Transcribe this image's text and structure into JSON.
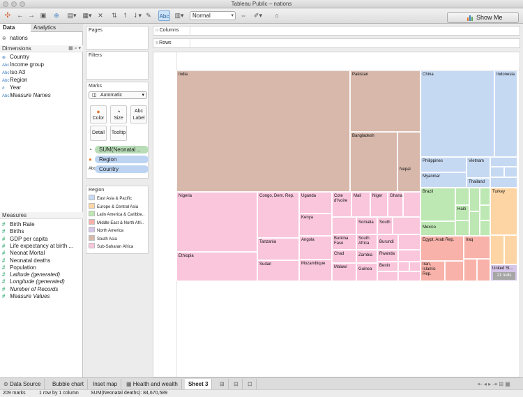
{
  "window": {
    "title": "Tableau Public – nations"
  },
  "toolbar": {
    "label_btn": "Abc",
    "view_mode": "Normal",
    "show_me": "Show Me"
  },
  "data_pane": {
    "tabs": [
      "Data",
      "Analytics"
    ],
    "datasource": "nations",
    "dimensions_header": "Dimensions",
    "dimensions": [
      {
        "label": "Country",
        "icon": "globe-icon",
        "italic": false
      },
      {
        "label": "Income group",
        "icon": "abc-icon",
        "italic": false
      },
      {
        "label": "Iso A3",
        "icon": "abc-icon",
        "italic": false
      },
      {
        "label": "Region",
        "icon": "abc-icon",
        "italic": false
      },
      {
        "label": "Year",
        "icon": "number-icon",
        "italic": false
      },
      {
        "label": "Measure Names",
        "icon": "abc-icon",
        "italic": true
      }
    ],
    "measures_header": "Measures",
    "measures": [
      {
        "label": "Birth Rate",
        "italic": false
      },
      {
        "label": "Births",
        "italic": false
      },
      {
        "label": "GDP per capita",
        "italic": false
      },
      {
        "label": "Life expectancy at birth ...",
        "italic": false
      },
      {
        "label": "Neonat Mortal",
        "italic": false
      },
      {
        "label": "Neonatal deaths",
        "italic": false
      },
      {
        "label": "Population",
        "italic": false
      },
      {
        "label": "Latitude (generated)",
        "italic": true
      },
      {
        "label": "Longitude (generated)",
        "italic": true
      },
      {
        "label": "Number of Records",
        "italic": true
      },
      {
        "label": "Measure Values",
        "italic": true
      }
    ]
  },
  "cards": {
    "pages": "Pages",
    "filters": "Filters",
    "marks": "Marks",
    "mark_type": "Automatic",
    "mark_buttons": [
      "Color",
      "Size",
      "Label",
      "Detail",
      "Tooltip"
    ],
    "mark_pills": [
      {
        "label": "SUM(Neonatal ..",
        "kind": "size"
      },
      {
        "label": "Region",
        "kind": "color"
      },
      {
        "label": "Country",
        "kind": "label"
      }
    ]
  },
  "legend": {
    "title": "Region",
    "items": [
      {
        "label": "East Asia & Pacific",
        "color": "#c6d9f2"
      },
      {
        "label": "Europe & Central Asia",
        "color": "#fdd5a4"
      },
      {
        "label": "Latin America & Caribbe..",
        "color": "#bde7b3"
      },
      {
        "label": "Middle East & North Afri..",
        "color": "#f8b2a9"
      },
      {
        "label": "North America",
        "color": "#d6c6e9"
      },
      {
        "label": "South Asia",
        "color": "#d7b8ab"
      },
      {
        "label": "Sub-Saharan Africa",
        "color": "#f9c6dc"
      }
    ]
  },
  "shelves": {
    "columns": "Columns",
    "rows": "Rows"
  },
  "treemap": {
    "labels": {
      "india": "India",
      "pakistan": "Pakistan",
      "bangladesh": "Bangladesh",
      "nepal": "Nepal",
      "china": "China",
      "indonesia": "Indonesia",
      "philippines": "Philippines",
      "vietnam": "Vietnam",
      "myanmar": "Myanmar",
      "thailand": "Thailand",
      "nigeria": "Nigeria",
      "ethiopia": "Ethiopia",
      "congo": "Congo, Dem. Rep.",
      "tanzania": "Tanzania",
      "sudan": "Sudan",
      "uganda": "Uganda",
      "kenya": "Kenya",
      "angola": "Angola",
      "mozambique": "Mozambique",
      "cote": "Cote d'Ivoire",
      "mali": "Mali",
      "niger": "Niger",
      "ghana": "Ghana",
      "somalia": "Somalia",
      "south": "South",
      "burkina": "Burkina Faso",
      "southafrica": "South Africa",
      "burundi": "Burundi",
      "chad": "Chad",
      "zambia": "Zambia",
      "rwanda": "Rwanda",
      "malawi": "Malawi",
      "guinea": "Guinea",
      "benin": "Benin",
      "brazil": "Brazil",
      "haiti": "Haiti",
      "mexico": "Mexico",
      "turkey": "Turkey",
      "egypt": "Egypt, Arab Rep.",
      "iraq": "Iraq",
      "iran": "Iran, Islamic Rep.",
      "us": "United St..."
    },
    "nulls": "21 nulls"
  },
  "sheet_tabs": [
    "Data Source",
    "Bubble chart",
    "Inset map",
    "Health and wealth",
    "Sheet 3"
  ],
  "status": {
    "marks": "209 marks",
    "rows_cols": "1 row by 1 column",
    "sum": "SUM(Neonatal deaths): 84,670,589"
  }
}
